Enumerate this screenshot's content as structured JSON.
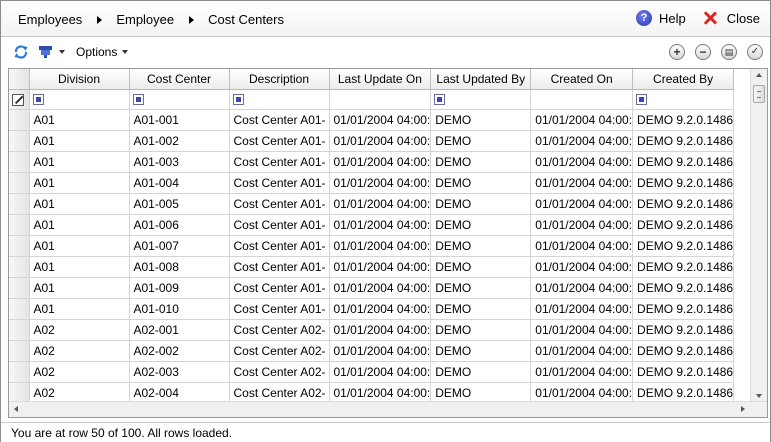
{
  "breadcrumb": [
    "Employees",
    "Employee",
    "Cost Centers"
  ],
  "header": {
    "help_label": "Help",
    "close_label": "Close"
  },
  "toolbar": {
    "options_label": "Options"
  },
  "grid": {
    "columns": [
      "Division",
      "Cost Center",
      "Description",
      "Last Update On",
      "Last Updated By",
      "Created On",
      "Created By"
    ],
    "rows": [
      [
        "A01",
        "A01-001",
        "Cost Center A01-",
        "01/01/2004 04:00:",
        "DEMO",
        "01/01/2004 04:00:",
        "DEMO 9.2.0.1486"
      ],
      [
        "A01",
        "A01-002",
        "Cost Center A01-",
        "01/01/2004 04:00:",
        "DEMO",
        "01/01/2004 04:00:",
        "DEMO 9.2.0.1486"
      ],
      [
        "A01",
        "A01-003",
        "Cost Center A01-",
        "01/01/2004 04:00:",
        "DEMO",
        "01/01/2004 04:00:",
        "DEMO 9.2.0.1486"
      ],
      [
        "A01",
        "A01-004",
        "Cost Center A01-",
        "01/01/2004 04:00:",
        "DEMO",
        "01/01/2004 04:00:",
        "DEMO 9.2.0.1486"
      ],
      [
        "A01",
        "A01-005",
        "Cost Center A01-",
        "01/01/2004 04:00:",
        "DEMO",
        "01/01/2004 04:00:",
        "DEMO 9.2.0.1486"
      ],
      [
        "A01",
        "A01-006",
        "Cost Center A01-",
        "01/01/2004 04:00:",
        "DEMO",
        "01/01/2004 04:00:",
        "DEMO 9.2.0.1486"
      ],
      [
        "A01",
        "A01-007",
        "Cost Center A01-",
        "01/01/2004 04:00:",
        "DEMO",
        "01/01/2004 04:00:",
        "DEMO 9.2.0.1486"
      ],
      [
        "A01",
        "A01-008",
        "Cost Center A01-",
        "01/01/2004 04:00:",
        "DEMO",
        "01/01/2004 04:00:",
        "DEMO 9.2.0.1486"
      ],
      [
        "A01",
        "A01-009",
        "Cost Center A01-",
        "01/01/2004 04:00:",
        "DEMO",
        "01/01/2004 04:00:",
        "DEMO 9.2.0.1486"
      ],
      [
        "A01",
        "A01-010",
        "Cost Center A01-",
        "01/01/2004 04:00:",
        "DEMO",
        "01/01/2004 04:00:",
        "DEMO 9.2.0.1486"
      ],
      [
        "A02",
        "A02-001",
        "Cost Center A02-",
        "01/01/2004 04:00:",
        "DEMO",
        "01/01/2004 04:00:",
        "DEMO 9.2.0.1486"
      ],
      [
        "A02",
        "A02-002",
        "Cost Center A02-",
        "01/01/2004 04:00:",
        "DEMO",
        "01/01/2004 04:00:",
        "DEMO 9.2.0.1486"
      ],
      [
        "A02",
        "A02-003",
        "Cost Center A02-",
        "01/01/2004 04:00:",
        "DEMO",
        "01/01/2004 04:00:",
        "DEMO 9.2.0.1486"
      ],
      [
        "A02",
        "A02-004",
        "Cost Center A02-",
        "01/01/2004 04:00:",
        "DEMO",
        "01/01/2004 04:00:",
        "DEMO 9.2.0.1486"
      ]
    ]
  },
  "status": {
    "text": "You are at row 50 of 100. All rows loaded."
  },
  "colors": {
    "help_blue": "#2a35b5",
    "close_red": "#d8281f",
    "refresh_blue": "#2a7ad6"
  },
  "icons": [
    "help-icon",
    "close-icon",
    "refresh-icon",
    "filter-icon",
    "add-icon",
    "remove-icon",
    "layout-icon",
    "check-icon",
    "edit-icon"
  ]
}
